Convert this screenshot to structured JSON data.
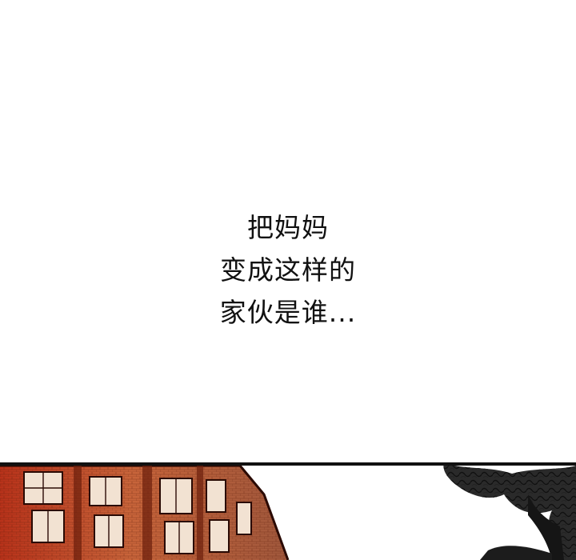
{
  "caption": {
    "line1": "把妈妈",
    "line2": "变成这样的",
    "line3": "家伙是谁..."
  },
  "panel": {
    "building_color": "#c8502a",
    "building_shadow": "#6b1e0c",
    "tree_color": "#1a1a1a",
    "sky_color": "#ffffff"
  }
}
